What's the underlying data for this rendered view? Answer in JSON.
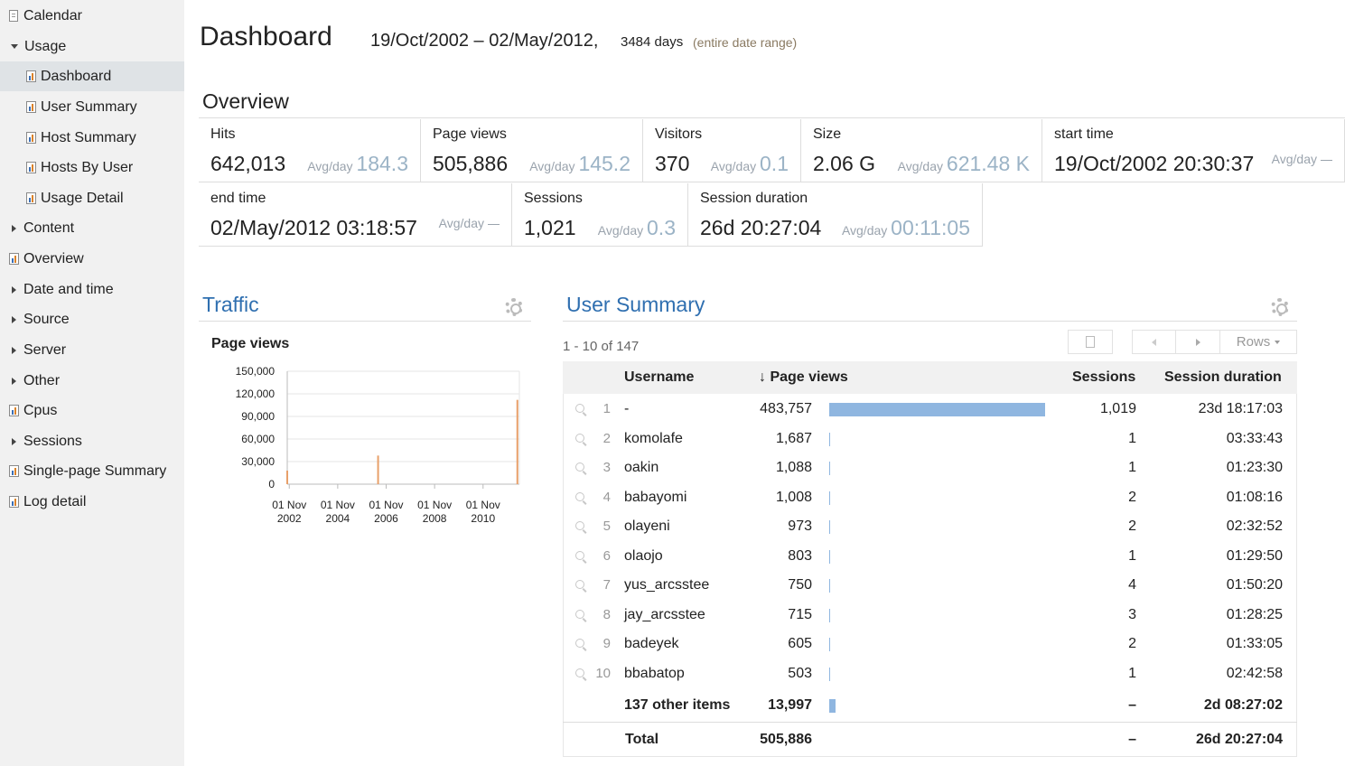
{
  "sidebar": {
    "items": [
      {
        "label": "Calendar",
        "icon": "page-icon"
      },
      {
        "label": "Usage",
        "icon": "caret-down-icon"
      },
      {
        "label": "Dashboard",
        "icon": "report-icon"
      },
      {
        "label": "User Summary",
        "icon": "report-icon"
      },
      {
        "label": "Host Summary",
        "icon": "report-icon"
      },
      {
        "label": "Hosts By User",
        "icon": "report-icon"
      },
      {
        "label": "Usage Detail",
        "icon": "report-icon"
      },
      {
        "label": "Content",
        "icon": "caret-right-icon"
      },
      {
        "label": "Overview",
        "icon": "report-icon"
      },
      {
        "label": "Date and time",
        "icon": "caret-right-icon"
      },
      {
        "label": "Source",
        "icon": "caret-right-icon"
      },
      {
        "label": "Server",
        "icon": "caret-right-icon"
      },
      {
        "label": "Other",
        "icon": "caret-right-icon"
      },
      {
        "label": "Cpus",
        "icon": "report-icon"
      },
      {
        "label": "Sessions",
        "icon": "caret-right-icon"
      },
      {
        "label": "Single-page Summary",
        "icon": "report-icon"
      },
      {
        "label": "Log detail",
        "icon": "report-icon"
      }
    ],
    "active": "Dashboard"
  },
  "header": {
    "title": "Dashboard",
    "date_range": "19/Oct/2002 – 02/May/2012,",
    "days": "3484 days",
    "note": "(entire date range)"
  },
  "overview": {
    "heading": "Overview",
    "avg_label": "Avg/day",
    "tiles": [
      {
        "label": "Hits",
        "value": "642,013",
        "avg": "184.3"
      },
      {
        "label": "Page views",
        "value": "505,886",
        "avg": "145.2"
      },
      {
        "label": "Visitors",
        "value": "370",
        "avg": "0.1"
      },
      {
        "label": "Size",
        "value": "2.06 G",
        "avg": "621.48 K"
      },
      {
        "label": "start time",
        "value": "19/Oct/2002 20:30:37",
        "avg": ""
      },
      {
        "label": "end time",
        "value": "02/May/2012 03:18:57",
        "avg": ""
      },
      {
        "label": "Sessions",
        "value": "1,021",
        "avg": "0.3"
      },
      {
        "label": "Session duration",
        "value": "26d 20:27:04",
        "avg": "00:11:05"
      }
    ]
  },
  "traffic": {
    "title": "Traffic"
  },
  "chart_data": {
    "type": "bar",
    "title": "Page views",
    "ylim": [
      0,
      150000
    ],
    "yticks": [
      "0",
      "30,000",
      "60,000",
      "90,000",
      "120,000",
      "150,000"
    ],
    "xticks": [
      {
        "line1": "01 Nov",
        "line2": "2002"
      },
      {
        "line1": "01 Nov",
        "line2": "2004"
      },
      {
        "line1": "01 Nov",
        "line2": "2006"
      },
      {
        "line1": "01 Nov",
        "line2": "2008"
      },
      {
        "line1": "01 Nov",
        "line2": "2010"
      }
    ],
    "x": [
      "2002-10",
      "2006-07",
      "2012-04"
    ],
    "values": [
      18000,
      38000,
      112000
    ],
    "color": "#e8a06a",
    "grid": true
  },
  "user_summary": {
    "title": "User Summary",
    "pager": "1 - 10 of 147",
    "rows_label": "Rows",
    "columns": {
      "username": "Username",
      "page_views": "Page views",
      "sessions": "Sessions",
      "duration": "Session duration"
    },
    "max_page_views": 483757,
    "rows": [
      {
        "rank": "1",
        "username": "-",
        "page_views": "483,757",
        "pv": 483757,
        "sessions": "1,019",
        "duration": "23d 18:17:03"
      },
      {
        "rank": "2",
        "username": "komolafe",
        "page_views": "1,687",
        "pv": 1687,
        "sessions": "1",
        "duration": "03:33:43"
      },
      {
        "rank": "3",
        "username": "oakin",
        "page_views": "1,088",
        "pv": 1088,
        "sessions": "1",
        "duration": "01:23:30"
      },
      {
        "rank": "4",
        "username": "babayomi",
        "page_views": "1,008",
        "pv": 1008,
        "sessions": "2",
        "duration": "01:08:16"
      },
      {
        "rank": "5",
        "username": "olayeni",
        "page_views": "973",
        "pv": 973,
        "sessions": "2",
        "duration": "02:32:52"
      },
      {
        "rank": "6",
        "username": "olaojo",
        "page_views": "803",
        "pv": 803,
        "sessions": "1",
        "duration": "01:29:50"
      },
      {
        "rank": "7",
        "username": "yus_arcsstee",
        "page_views": "750",
        "pv": 750,
        "sessions": "4",
        "duration": "01:50:20"
      },
      {
        "rank": "8",
        "username": "jay_arcsstee",
        "page_views": "715",
        "pv": 715,
        "sessions": "3",
        "duration": "01:28:25"
      },
      {
        "rank": "9",
        "username": "badeyek",
        "page_views": "605",
        "pv": 605,
        "sessions": "2",
        "duration": "01:33:05"
      },
      {
        "rank": "10",
        "username": "bbabatop",
        "page_views": "503",
        "pv": 503,
        "sessions": "1",
        "duration": "02:42:58"
      }
    ],
    "other": {
      "label": "137 other items",
      "page_views": "13,997",
      "pv": 13997,
      "sessions": "–",
      "duration": "2d 08:27:02"
    },
    "total": {
      "label": "Total",
      "page_views": "505,886",
      "sessions": "–",
      "duration": "26d 20:27:04"
    }
  }
}
